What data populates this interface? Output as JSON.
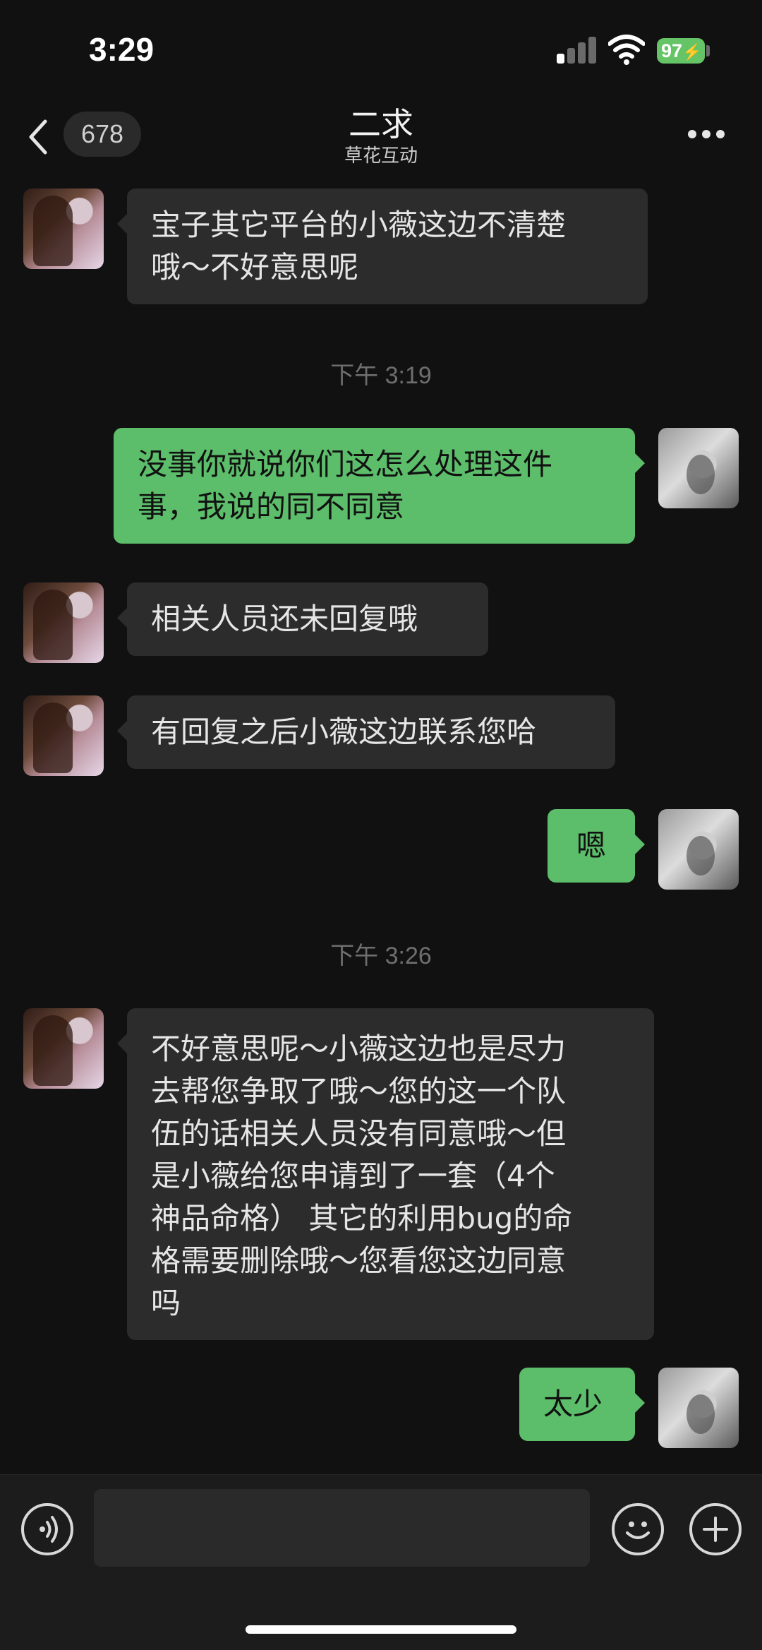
{
  "status_bar": {
    "time": "3:29",
    "battery": "97"
  },
  "header": {
    "unread_count": "678",
    "title": "二求",
    "subtitle": "草花互动"
  },
  "messages": [
    {
      "type": "in",
      "text": "宝子其它平台的小薇这边不清楚\n哦～不好意思呢"
    },
    {
      "type": "time",
      "text": "下午 3:19"
    },
    {
      "type": "out",
      "text": "没事你就说你们这怎么处理这件\n事，我说的同不同意"
    },
    {
      "type": "in",
      "text": "相关人员还未回复哦"
    },
    {
      "type": "in",
      "text": "有回复之后小薇这边联系您哈"
    },
    {
      "type": "out",
      "text": "嗯"
    },
    {
      "type": "time",
      "text": "下午 3:26"
    },
    {
      "type": "in",
      "text": "不好意思呢～小薇这边也是尽力\n去帮您争取了哦～您的这一个队\n伍的话相关人员没有同意哦～但\n是小薇给您申请到了一套（4个\n神品命格） 其它的利用bug的命\n格需要删除哦～您看您这边同意\n吗"
    },
    {
      "type": "out",
      "text": "太少"
    }
  ],
  "input_bar": {
    "placeholder": "",
    "icons": [
      "voice-icon",
      "emoji-icon",
      "plus-icon"
    ]
  },
  "colors": {
    "background": "#111111",
    "incoming_bubble": "#2c2c2c",
    "outgoing_bubble": "#5cbd6a",
    "battery": "#65c466"
  }
}
